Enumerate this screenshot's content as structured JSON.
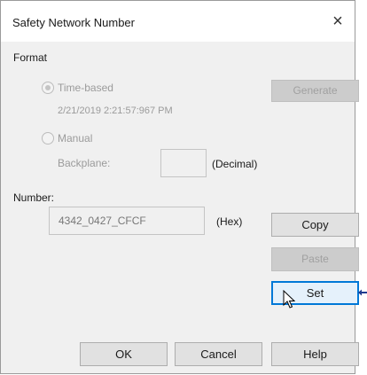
{
  "window": {
    "title": "Safety Network Number",
    "close_icon": "×"
  },
  "format": {
    "label": "Format",
    "time_based": {
      "label": "Time-based",
      "selected": true,
      "timestamp": "2/21/2019 2:21:57:967 PM"
    },
    "generate_label": "Generate",
    "manual": {
      "label": "Manual",
      "selected": false
    },
    "backplane": {
      "label": "Backplane:",
      "value": "",
      "unit": "(Decimal)"
    }
  },
  "number": {
    "label": "Number:",
    "value": "4342_0427_CFCF",
    "unit": "(Hex)"
  },
  "actions": {
    "copy": "Copy",
    "paste": "Paste",
    "set": "Set"
  },
  "footer": {
    "ok": "OK",
    "cancel": "Cancel",
    "help": "Help"
  },
  "colors": {
    "focus_border": "#0078d7",
    "arrow": "#1f3b8f"
  }
}
